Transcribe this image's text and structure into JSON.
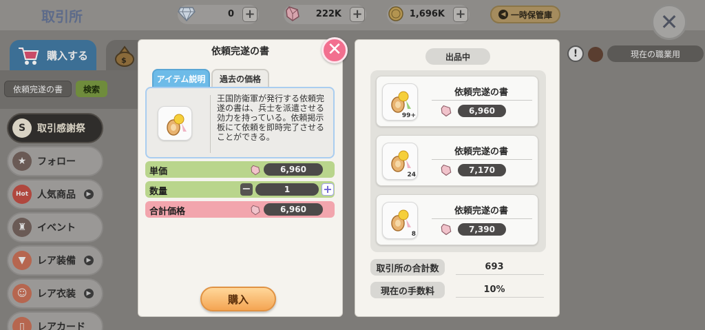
{
  "header": {
    "title": "取引所",
    "currencies": [
      {
        "icon": "diamond-icon",
        "value": "0"
      },
      {
        "icon": "zeny-gem-icon",
        "value": "222K"
      },
      {
        "icon": "coin-icon",
        "value": "1,696K"
      }
    ],
    "storage_label": "一時保管庫"
  },
  "tabs": {
    "buy_label": "購入する"
  },
  "search": {
    "value": "依頼完遂の書",
    "button_label": "検索"
  },
  "sidebar": {
    "items": [
      {
        "label": "取引感謝祭",
        "icon": "zeny-badge-icon"
      },
      {
        "label": "フォロー",
        "icon": "star-icon"
      },
      {
        "label": "人気商品",
        "icon": "hot-icon"
      },
      {
        "label": "イベント",
        "icon": "bell-icon"
      },
      {
        "label": "レア装備",
        "icon": "armor-icon"
      },
      {
        "label": "レア衣装",
        "icon": "costume-icon"
      },
      {
        "label": "レアカード",
        "icon": "card-icon"
      }
    ]
  },
  "job_filter": "現在の職業用",
  "dialog": {
    "title": "依頼完遂の書",
    "tabs": [
      "アイテム説明",
      "過去の価格"
    ],
    "description": "王国防衛軍が発行する依頼完遂の書は、兵士を派遣させる効力を持っている。依頼掲示板にて依頼を即時完了させることができる。",
    "unit_price_label": "単価",
    "unit_price": "6,960",
    "quantity_label": "数量",
    "quantity": "1",
    "total_label": "合計価格",
    "total": "6,960",
    "buy_label": "購入"
  },
  "listings": {
    "title": "出品中",
    "items": [
      {
        "name": "依頼完遂の書",
        "price": "6,960",
        "count": "99+"
      },
      {
        "name": "依頼完遂の書",
        "price": "7,170",
        "count": "24"
      },
      {
        "name": "依頼完遂の書",
        "price": "7,390",
        "count": "8"
      }
    ],
    "total_count_label": "取引所の合計数",
    "total_count": "693",
    "fee_label": "現在の手数料",
    "fee": "10%"
  },
  "colors": {
    "accent_blue": "#6dbbe8",
    "row_green": "#b9d58c",
    "row_pink": "#f2a5ad",
    "buy_orange": "#f4a553",
    "close_pink": "#f26f8f"
  }
}
